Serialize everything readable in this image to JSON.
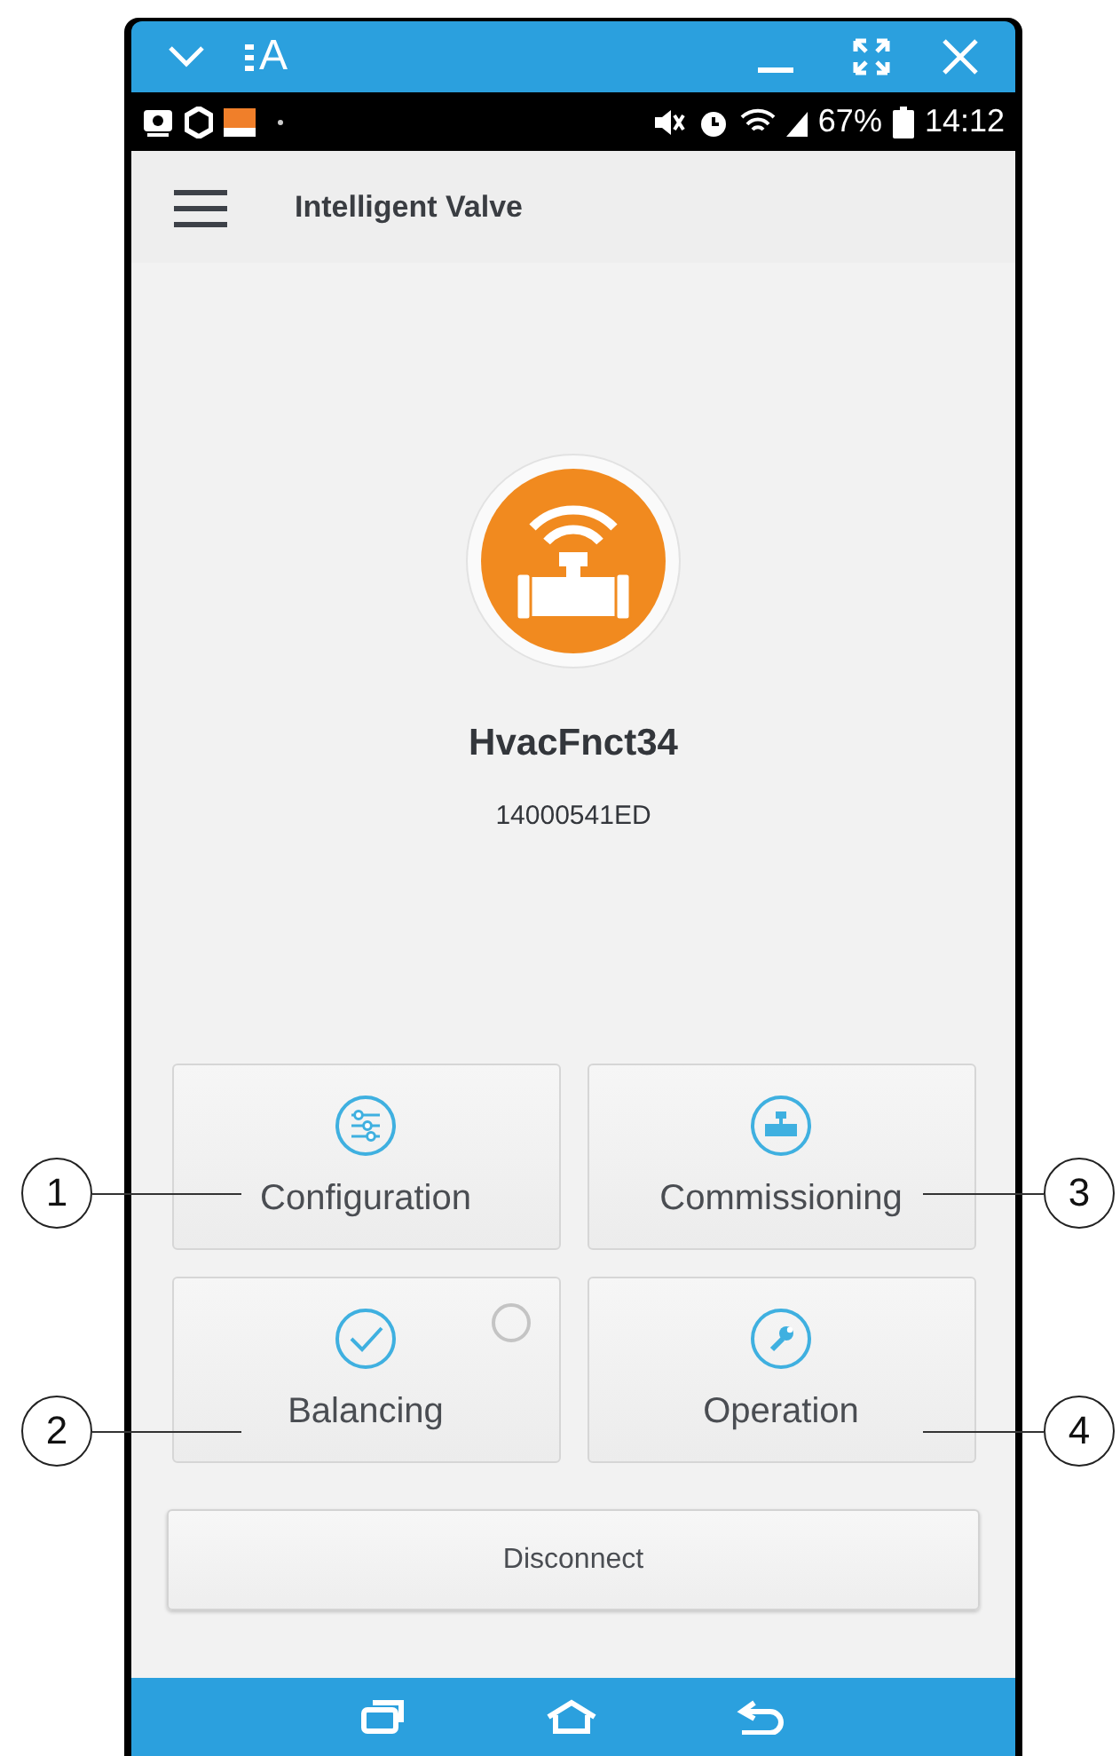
{
  "window_bar": {
    "font_button_label": "A"
  },
  "status_bar": {
    "battery": "67%",
    "time": "14:12"
  },
  "app_bar": {
    "title": "Intelligent Valve"
  },
  "device": {
    "name": "HvacFnct34",
    "serial": "14000541ED"
  },
  "tiles": [
    {
      "label": "Configuration",
      "callout": "1"
    },
    {
      "label": "Commissioning",
      "callout": "3"
    },
    {
      "label": "Balancing",
      "callout": "2",
      "indicator": {
        "checked": false
      }
    },
    {
      "label": "Operation",
      "callout": "4"
    }
  ],
  "disconnect_button": {
    "label": "Disconnect"
  }
}
